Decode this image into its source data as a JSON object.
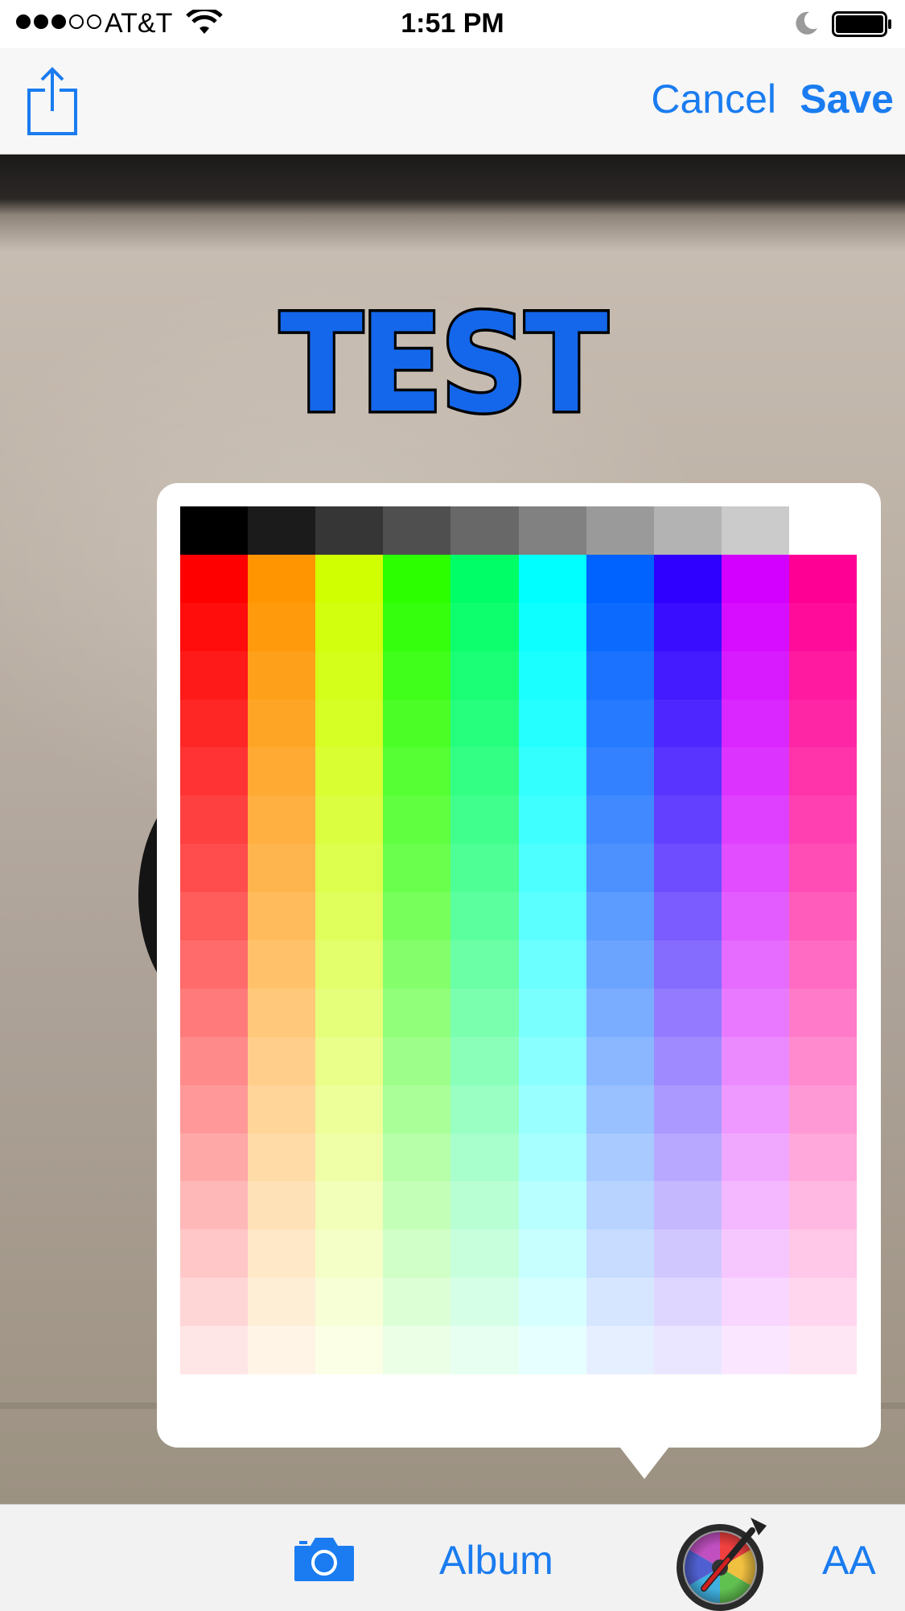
{
  "status_bar": {
    "signal_dots_filled": 3,
    "signal_dots_total": 5,
    "carrier": "AT&T",
    "time": "1:51 PM",
    "icons": [
      "wifi-icon",
      "moon-icon",
      "battery-icon"
    ]
  },
  "nav_bar": {
    "share_icon": "share-icon",
    "cancel_label": "Cancel",
    "save_label": "Save"
  },
  "canvas": {
    "overlay_text": "TEST",
    "text_fill_color": "#1467ea",
    "text_stroke_color": "#000000"
  },
  "color_picker": {
    "grayscale_row": [
      "#000000",
      "#1b1b1b",
      "#363636",
      "#4f4f4f",
      "#686868",
      "#818181",
      "#9a9a9a",
      "#b3b3b3",
      "#cbcbcb",
      "#ffffff"
    ],
    "hue_columns": [
      "#ff0000",
      "#ff9500",
      "#cfff00",
      "#2bff00",
      "#00ff66",
      "#00ffff",
      "#0062ff",
      "#2f00ff",
      "#d400ff",
      "#ff0095"
    ],
    "tint_rows": 17,
    "tint_steps": [
      0.0,
      0.05,
      0.1,
      0.15,
      0.2,
      0.25,
      0.3,
      0.36,
      0.42,
      0.48,
      0.54,
      0.6,
      0.66,
      0.72,
      0.78,
      0.84,
      0.9
    ]
  },
  "toolbar": {
    "camera_icon": "camera-icon",
    "album_label": "Album",
    "color_wheel_icon": "color-wheel-icon",
    "aa_label": "AA"
  },
  "colors": {
    "accent": "#1a7cf0"
  }
}
